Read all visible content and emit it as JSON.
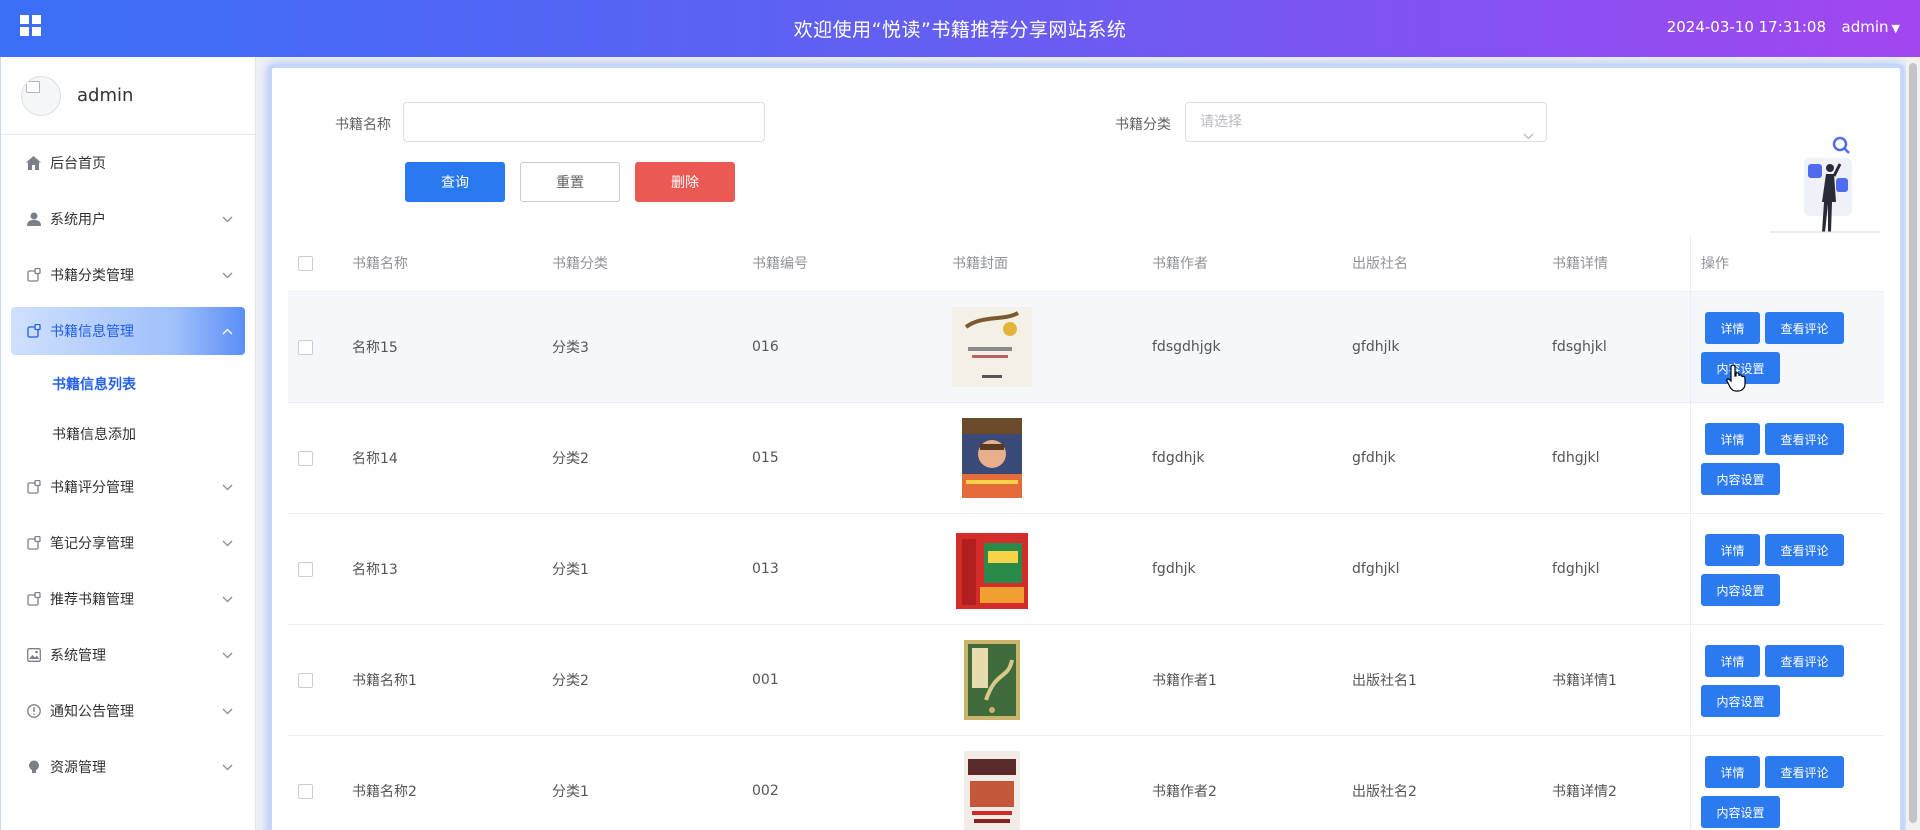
{
  "header": {
    "title": "欢迎使用“悦读”书籍推荐分享网站系统",
    "datetime": "2024-03-10 17:31:08",
    "user": "admin"
  },
  "sidebar": {
    "profile_name": "admin",
    "items": [
      {
        "label": "后台首页",
        "icon": "home-icon",
        "expandable": false
      },
      {
        "label": "系统用户",
        "icon": "user-icon",
        "expandable": true
      },
      {
        "label": "书籍分类管理",
        "icon": "module-icon",
        "expandable": true
      },
      {
        "label": "书籍信息管理",
        "icon": "module-icon",
        "expandable": true,
        "active": true
      },
      {
        "label": "书籍评分管理",
        "icon": "module-icon",
        "expandable": true
      },
      {
        "label": "笔记分享管理",
        "icon": "module-icon",
        "expandable": true
      },
      {
        "label": "推荐书籍管理",
        "icon": "module-icon",
        "expandable": true
      },
      {
        "label": "系统管理",
        "icon": "image-icon",
        "expandable": true
      },
      {
        "label": "通知公告管理",
        "icon": "info-icon",
        "expandable": true
      },
      {
        "label": "资源管理",
        "icon": "bulb-icon",
        "expandable": true
      }
    ],
    "sub_items": [
      {
        "label": "书籍信息列表",
        "current": true
      },
      {
        "label": "书籍信息添加",
        "current": false
      }
    ]
  },
  "search": {
    "name_label": "书籍名称",
    "name_value": "",
    "category_label": "书籍分类",
    "category_placeholder": "请选择",
    "query_button": "查询",
    "reset_button": "重置",
    "delete_button": "删除"
  },
  "table": {
    "columns": [
      "书籍名称",
      "书籍分类",
      "书籍编号",
      "书籍封面",
      "书籍作者",
      "出版社名",
      "书籍详情",
      "操作"
    ],
    "op_labels": {
      "detail": "详情",
      "comments": "查看评论",
      "content": "内容设置"
    },
    "rows": [
      {
        "name": "名称15",
        "category": "分类3",
        "number": "016",
        "author": "fdsgdhjgk",
        "publisher": "gfdhjlk",
        "detail": "fdsghjkl",
        "cover_color": "#f2ede1"
      },
      {
        "name": "名称14",
        "category": "分类2",
        "number": "015",
        "author": "fdgdhjk",
        "publisher": "gfdhjk",
        "detail": "fdhgjkl",
        "cover_color": "#3f4e7a"
      },
      {
        "name": "名称13",
        "category": "分类1",
        "number": "013",
        "author": "fgdhjk",
        "publisher": "dfghjkl",
        "detail": "fdghjkl",
        "cover_color": "#d42b2b"
      },
      {
        "name": "书籍名称1",
        "category": "分类2",
        "number": "001",
        "author": "书籍作者1",
        "publisher": "出版社名1",
        "detail": "书籍详情1",
        "cover_color": "#b9a15c"
      },
      {
        "name": "书籍名称2",
        "category": "分类1",
        "number": "002",
        "author": "书籍作者2",
        "publisher": "出版社名2",
        "detail": "书籍详情2",
        "cover_color": "#f3ece6"
      }
    ]
  },
  "colors": {
    "primary": "#2878f0",
    "danger": "#eb5a52",
    "header_gradient_start": "#3a6ff6",
    "header_gradient_end": "#a246f0"
  }
}
